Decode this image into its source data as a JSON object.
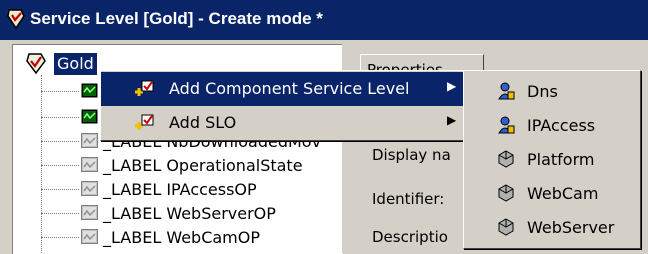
{
  "window": {
    "title": "Service Level [Gold] - Create mode *"
  },
  "tree": {
    "root_label": "Gold",
    "items": [
      {
        "label": "_",
        "icon": "service-level-node-icon"
      },
      {
        "label": "_",
        "icon": "service-level-node-icon"
      },
      {
        "label": "_LABEL NbDownloadedMov",
        "icon": "label-node-icon"
      },
      {
        "label": "_LABEL OperationalState",
        "icon": "label-node-icon"
      },
      {
        "label": "_LABEL IPAccessOP",
        "icon": "label-node-icon"
      },
      {
        "label": "_LABEL WebServerOP",
        "icon": "label-node-icon"
      },
      {
        "label": "_LABEL WebCamOP",
        "icon": "label-node-icon"
      }
    ]
  },
  "properties": {
    "tab_label": "Properties",
    "fields": [
      "Display na",
      "Identifier:",
      "Descriptio"
    ]
  },
  "context_menu": {
    "items": [
      {
        "label": "Add Component Service Level",
        "icon": "add-component-icon",
        "arrow": "▶"
      },
      {
        "label": "Add SLO",
        "icon": "add-slo-icon",
        "arrow": "▶"
      }
    ]
  },
  "submenu": {
    "items": [
      {
        "label": "Dns",
        "icon": "service-component-icon"
      },
      {
        "label": "IPAccess",
        "icon": "service-component-icon"
      },
      {
        "label": "Platform",
        "icon": "resource-icon"
      },
      {
        "label": "WebCam",
        "icon": "resource-icon"
      },
      {
        "label": "WebServer",
        "icon": "resource-icon"
      }
    ]
  },
  "colors": {
    "title_bg": "#0a2468",
    "selection": "#0a246a",
    "face": "#d4d0c8"
  }
}
